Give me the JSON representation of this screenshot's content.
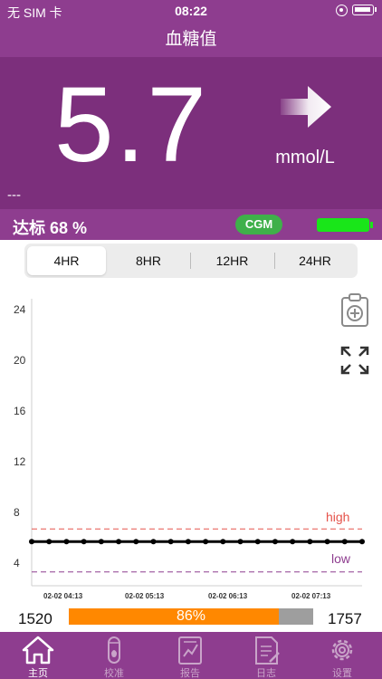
{
  "status_bar": {
    "carrier": "无 SIM 卡",
    "time": "08:22"
  },
  "header": {
    "title": "血糖值"
  },
  "reading": {
    "value": "5.7",
    "unit": "mmol/L",
    "trend_icon": "arrow-right-icon",
    "placeholder": "---"
  },
  "info": {
    "target_label": "达标",
    "target_value": "68 %",
    "cgm_label": "CGM",
    "battery_color": "#19e619"
  },
  "ranges": {
    "tabs": [
      "4HR",
      "8HR",
      "12HR",
      "24HR"
    ],
    "selected": "4HR"
  },
  "summary": {
    "left_count": "1520",
    "right_count": "1757",
    "percent_label": "86%",
    "percent": 86
  },
  "chart_data": {
    "type": "line",
    "title": "",
    "xlabel": "",
    "ylabel": "",
    "ylim": [
      4,
      24
    ],
    "yticks": [
      24,
      20,
      16,
      12,
      8,
      4
    ],
    "xticks": [
      "02-02 04:13",
      "02-02 05:13",
      "02-02 06:13",
      "02-02 07:13"
    ],
    "series": [
      {
        "values": [
          5.7,
          5.7,
          5.7,
          5.7,
          5.7,
          5.7,
          5.7,
          5.7,
          5.7,
          5.7,
          5.7,
          5.7,
          5.7,
          5.7,
          5.7,
          5.7,
          5.7,
          5.7,
          5.7,
          5.7
        ]
      }
    ],
    "high": {
      "label": "high",
      "value": 6.7,
      "color": "#e5534b"
    },
    "low": {
      "label": "low",
      "value": 3.3,
      "color": "#8e3d8f"
    },
    "grid": false
  },
  "tabbar": {
    "items": [
      {
        "label": "主页",
        "icon": "home-icon"
      },
      {
        "label": "校准",
        "icon": "drop-icon"
      },
      {
        "label": "报告",
        "icon": "report-icon"
      },
      {
        "label": "日志",
        "icon": "log-icon"
      },
      {
        "label": "设置",
        "icon": "gear-icon"
      }
    ],
    "active": 0
  },
  "colors": {
    "primary": "#8e3d8f",
    "panel": "#7c2f7c",
    "accent": "#ff8800",
    "ok": "#3fb04a"
  }
}
